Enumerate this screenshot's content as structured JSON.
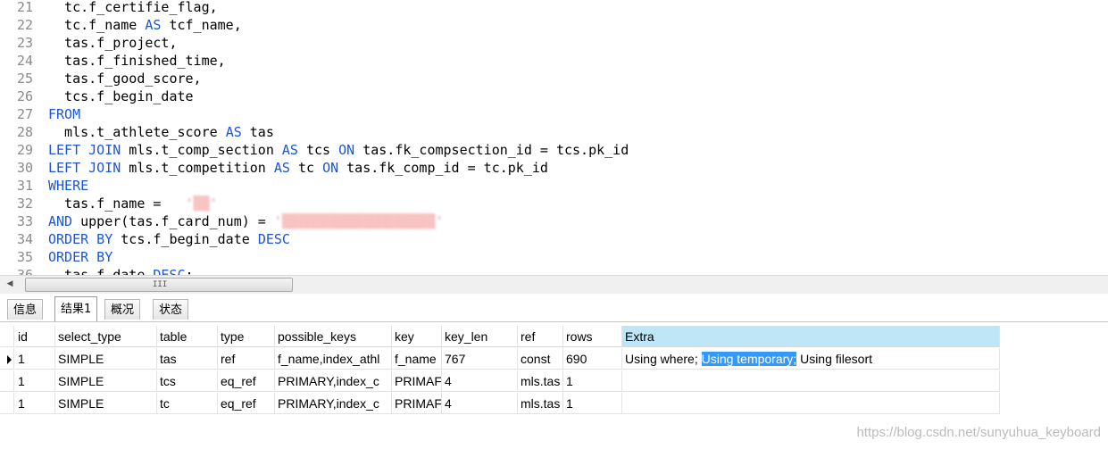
{
  "editor": {
    "lines": [
      {
        "n": "21",
        "t": [
          {
            "c": "  tc.f_certifie_flag,"
          }
        ]
      },
      {
        "n": "22",
        "t": [
          {
            "c": "  tc.f_name "
          },
          {
            "c": "AS",
            "k": "kw"
          },
          {
            "c": " tcf_name,"
          }
        ]
      },
      {
        "n": "23",
        "t": [
          {
            "c": "  tas.f_project,"
          }
        ]
      },
      {
        "n": "24",
        "t": [
          {
            "c": "  tas.f_finished_time,"
          }
        ]
      },
      {
        "n": "25",
        "t": [
          {
            "c": "  tas.f_good_score,"
          }
        ]
      },
      {
        "n": "26",
        "t": [
          {
            "c": "  tcs.f_begin_date"
          }
        ]
      },
      {
        "n": "27",
        "t": [
          {
            "c": "FROM",
            "k": "kw"
          }
        ]
      },
      {
        "n": "28",
        "t": [
          {
            "c": "  mls.t_athlete_score "
          },
          {
            "c": "AS",
            "k": "kw"
          },
          {
            "c": " tas"
          }
        ]
      },
      {
        "n": "29",
        "t": [
          {
            "c": "LEFT JOIN",
            "k": "kw"
          },
          {
            "c": " mls.t_comp_section "
          },
          {
            "c": "AS",
            "k": "kw"
          },
          {
            "c": " tcs "
          },
          {
            "c": "ON",
            "k": "kw"
          },
          {
            "c": " tas.fk_compsection_id = tcs.pk_id"
          }
        ]
      },
      {
        "n": "30",
        "t": [
          {
            "c": "LEFT JOIN",
            "k": "kw"
          },
          {
            "c": " mls.t_competition "
          },
          {
            "c": "AS",
            "k": "kw"
          },
          {
            "c": " tc "
          },
          {
            "c": "ON",
            "k": "kw"
          },
          {
            "c": " tas.fk_comp_id = tc.pk_id"
          }
        ]
      },
      {
        "n": "31",
        "t": [
          {
            "c": "WHERE",
            "k": "kw"
          }
        ]
      },
      {
        "n": "32",
        "t": [
          {
            "c": "  tas.f_name = "
          },
          {
            "c": "  '▒▒'",
            "k": "blur"
          }
        ]
      },
      {
        "n": "33",
        "t": [
          {
            "c": "AND",
            "k": "kw"
          },
          {
            "c": " upper(tas.f_card_num) = "
          },
          {
            "c": "'▒▒▒▒▒▒▒▒▒▒▒▒▒▒▒▒▒▒▒'",
            "k": "blur"
          }
        ]
      },
      {
        "n": "34",
        "t": [
          {
            "c": "ORDER BY",
            "k": "kw"
          },
          {
            "c": " tcs.f_begin_date "
          },
          {
            "c": "DESC",
            "k": "kw"
          }
        ]
      },
      {
        "n": "35",
        "t": [
          {
            "c": "ORDER BY",
            "k": "kw"
          }
        ]
      },
      {
        "n": "36",
        "t": [
          {
            "c": "  tas.f_date "
          },
          {
            "c": "DESC",
            "k": "kw"
          },
          {
            "c": ";"
          }
        ]
      }
    ]
  },
  "scrollbar": {
    "left_arrow": "◀",
    "grip": "III"
  },
  "tabs": [
    {
      "label": "信息",
      "active": false
    },
    {
      "label": "结果1",
      "active": true
    },
    {
      "label": "概况",
      "active": false
    },
    {
      "label": "状态",
      "active": false
    }
  ],
  "grid": {
    "columns": [
      "id",
      "select_type",
      "table",
      "type",
      "possible_keys",
      "key",
      "key_len",
      "ref",
      "rows",
      "Extra"
    ],
    "rows": [
      {
        "current": true,
        "cells": [
          "1",
          "SIMPLE",
          "tas",
          "ref",
          "f_name,index_athl",
          "f_name",
          "767",
          "const",
          "690",
          ""
        ]
      },
      {
        "current": false,
        "cells": [
          "1",
          "SIMPLE",
          "tcs",
          "eq_ref",
          "PRIMARY,index_c",
          "PRIMAF",
          "4",
          "mls.tas",
          "1",
          ""
        ]
      },
      {
        "current": false,
        "cells": [
          "1",
          "SIMPLE",
          "tc",
          "eq_ref",
          "PRIMARY,index_c",
          "PRIMAF",
          "4",
          "mls.tas",
          "1",
          ""
        ]
      }
    ],
    "extra_first": {
      "before": "Using where; ",
      "highlight": "Using temporary;",
      "after": " Using filesort"
    }
  },
  "watermark": "https://blog.csdn.net/sunyuhua_keyboard"
}
